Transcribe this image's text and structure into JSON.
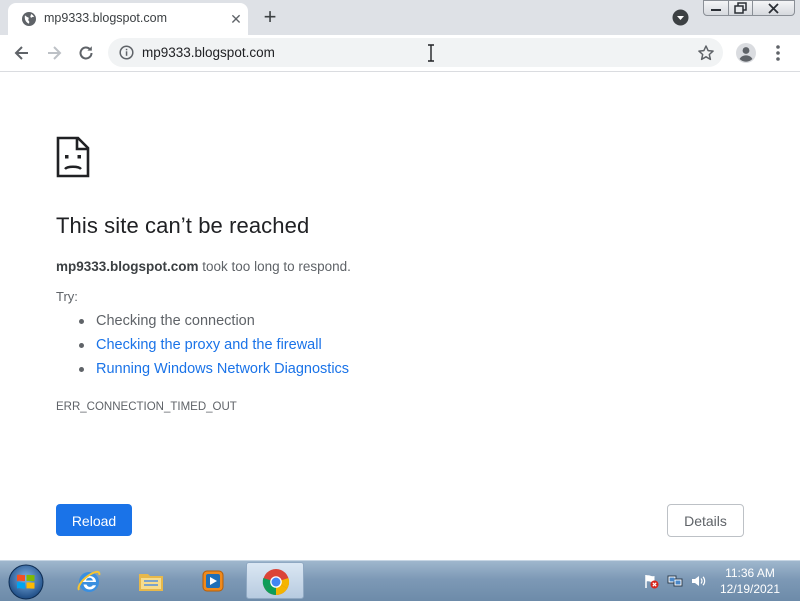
{
  "browser": {
    "tab": {
      "title": "mp9333.blogspot.com",
      "close_glyph": "✕"
    },
    "new_tab_glyph": "+",
    "omnibox": {
      "url": "mp9333.blogspot.com"
    },
    "icons": [
      "globe-icon",
      "close-icon",
      "plus-icon",
      "tab-search-icon",
      "back-icon",
      "forward-icon",
      "reload-icon",
      "info-icon",
      "star-icon",
      "profile-icon",
      "menu-icon"
    ]
  },
  "error_page": {
    "title": "This site can’t be reached",
    "host": "mp9333.blogspot.com",
    "message_suffix": " took too long to respond.",
    "try_label": "Try:",
    "suggestions": [
      {
        "text": "Checking the connection",
        "link": false
      },
      {
        "text": "Checking the proxy and the firewall",
        "link": true
      },
      {
        "text": "Running Windows Network Diagnostics",
        "link": true
      }
    ],
    "error_code": "ERR_CONNECTION_TIMED_OUT",
    "reload_label": "Reload",
    "details_label": "Details"
  },
  "taskbar": {
    "apps": [
      "internet-explorer",
      "file-explorer",
      "media-player",
      "chrome"
    ],
    "clock": {
      "time": "11:36 AM",
      "date": "12/19/2021"
    }
  },
  "colors": {
    "accent": "#1a73e8",
    "tabstrip": "#dee1e6",
    "omnibox": "#f1f3f4"
  }
}
